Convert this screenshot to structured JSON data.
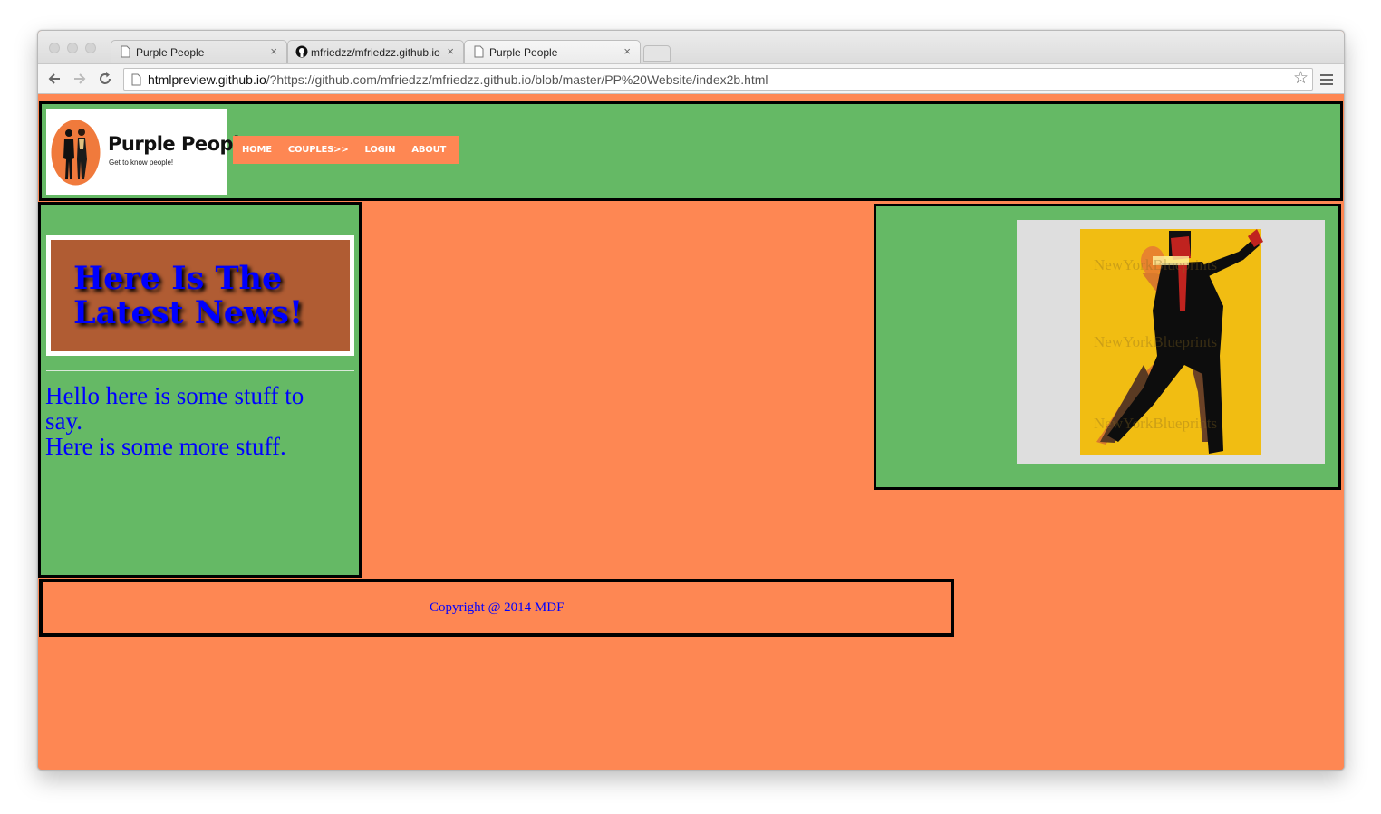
{
  "browser": {
    "tabs": [
      {
        "title": "Purple People",
        "active": false
      },
      {
        "title": "mfriedzz/mfriedzz.github.io",
        "active": false
      },
      {
        "title": "Purple People",
        "active": true
      }
    ],
    "url_host": "htmlpreview.github.io",
    "url_rest": "/?https://github.com/mfriedzz/mfriedzz.github.io/blob/master/PP%20Website/index2b.html",
    "close_glyph": "×"
  },
  "site": {
    "brand": "Purple People",
    "tagline": "Get to know people!",
    "nav": [
      "HOME",
      "COUPLES>>",
      "LOGIN",
      "ABOUT"
    ],
    "headline_line1": "Here Is The",
    "headline_line2": "Latest News!",
    "body_line1": "Hello here is some stuff to say.",
    "body_line2": "Here is some more stuff.",
    "footer": "Copyright @ 2014 MDF",
    "watermark": "NewYorkBlueprints"
  },
  "colors": {
    "page_bg": "#fe8753",
    "panel_green": "#65b965",
    "headline_blue": "#0000ff",
    "news_brown": "#b05c33"
  }
}
